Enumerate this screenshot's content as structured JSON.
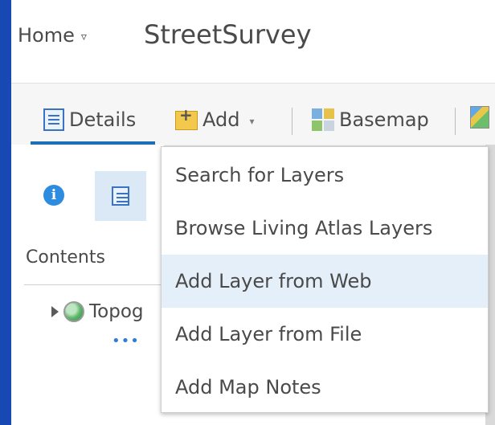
{
  "header": {
    "home_label": "Home",
    "home_caret": "▿",
    "app_title": "StreetSurvey"
  },
  "toolbar": {
    "details_label": "Details",
    "add_label": "Add",
    "add_caret": "▾",
    "basemap_label": "Basemap"
  },
  "panel": {
    "info_glyph": "i",
    "contents_label": "Contents",
    "layer_name": "Topog",
    "more_glyph": "•••"
  },
  "add_menu": {
    "items": [
      {
        "label": "Search for Layers"
      },
      {
        "label": "Browse Living Atlas Layers"
      },
      {
        "label": "Add Layer from Web",
        "highlighted": true
      },
      {
        "label": "Add Layer from File"
      },
      {
        "label": "Add Map Notes"
      }
    ]
  },
  "icons": {
    "details": "details-icon",
    "add": "add-icon",
    "basemap": "basemap-icon",
    "analysis": "analysis-icon",
    "info": "info-icon",
    "list": "list-icon",
    "expand": "expand-icon",
    "globe": "globe-icon",
    "more": "more-icon"
  },
  "colors": {
    "frame_blue": "#1748b4",
    "accent_blue": "#1f6fb8",
    "highlight_row": "#e4eff9",
    "tile_bg": "#dbe8f5"
  }
}
